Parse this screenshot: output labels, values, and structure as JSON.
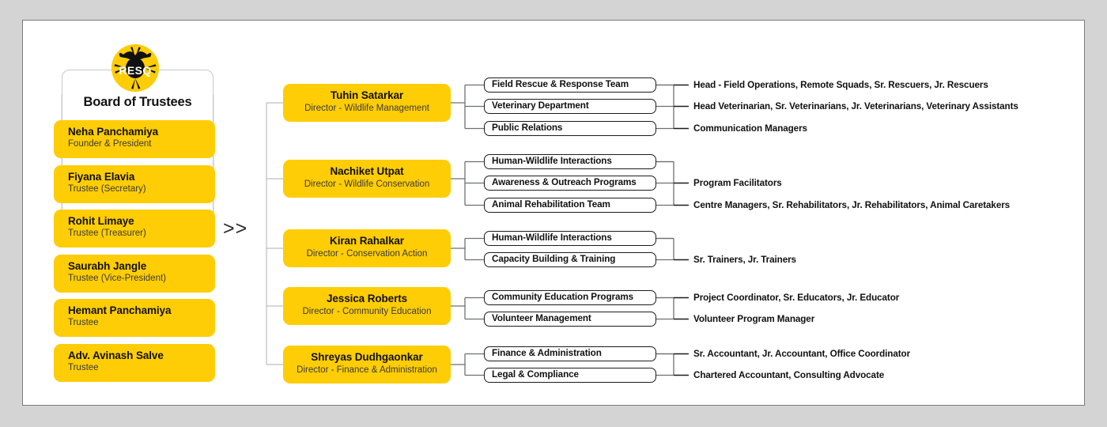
{
  "theme": {
    "page_background": "#d4d4d4",
    "card_background": "#ffffff",
    "accent_yellow": "#FFCD05",
    "text_dark": "#111111",
    "text_muted": "#3a3a3a",
    "line": "#b9b9b9"
  },
  "logo": {
    "name": "resq-logo",
    "wordmark": "RESQ"
  },
  "board": {
    "title": "Board of Trustees",
    "members": [
      {
        "name": "Neha Panchamiya",
        "role": "Founder & President"
      },
      {
        "name": "Fiyana Elavia",
        "role": "Trustee (Secretary)"
      },
      {
        "name": "Rohit Limaye",
        "role": "Trustee (Treasurer)"
      },
      {
        "name": "Saurabh Jangle",
        "role": "Trustee (Vice-President)"
      },
      {
        "name": "Hemant Panchamiya",
        "role": "Trustee"
      },
      {
        "name": "Adv. Avinash Salve",
        "role": "Trustee"
      }
    ]
  },
  "divider": {
    "chevrons": ">>"
  },
  "directors": [
    {
      "name": "Tuhin Satarkar",
      "role": "Director - Wildlife Management",
      "departments": [
        {
          "label": "Field Rescue & Response Team",
          "roles": "Head - Field Operations, Remote Squads, Sr. Rescuers, Jr. Rescuers"
        },
        {
          "label": "Veterinary Department",
          "roles": "Head Veterinarian, Sr. Veterinarians, Jr. Veterinarians, Veterinary Assistants"
        },
        {
          "label": "Public Relations",
          "roles": "Communication Managers"
        }
      ]
    },
    {
      "name": "Nachiket Utpat",
      "role": "Director - Wildlife Conservation",
      "departments": [
        {
          "label": "Human-Wildlife Interactions",
          "roles": ""
        },
        {
          "label": "Awareness & Outreach Programs",
          "roles": "Program Facilitators"
        },
        {
          "label": "Animal Rehabilitation Team",
          "roles": "Centre Managers, Sr. Rehabilitators, Jr. Rehabilitators, Animal Caretakers"
        }
      ]
    },
    {
      "name": "Kiran Rahalkar",
      "role": "Director - Conservation Action",
      "departments": [
        {
          "label": "Human-Wildlife Interactions",
          "roles": ""
        },
        {
          "label": "Capacity Building & Training",
          "roles": "Sr. Trainers, Jr. Trainers"
        }
      ]
    },
    {
      "name": "Jessica Roberts",
      "role": "Director - Community Education",
      "departments": [
        {
          "label": "Community Education Programs",
          "roles": "Project Coordinator, Sr. Educators, Jr. Educator"
        },
        {
          "label": "Volunteer Management",
          "roles": "Volunteer Program Manager"
        }
      ]
    },
    {
      "name": "Shreyas Dudhgaonkar",
      "role": "Director - Finance & Administration",
      "departments": [
        {
          "label": "Finance & Administration",
          "roles": "Sr. Accountant, Jr. Accountant, Office Coordinator"
        },
        {
          "label": "Legal & Compliance",
          "roles": "Chartered Accountant, Consulting Advocate"
        }
      ]
    }
  ]
}
